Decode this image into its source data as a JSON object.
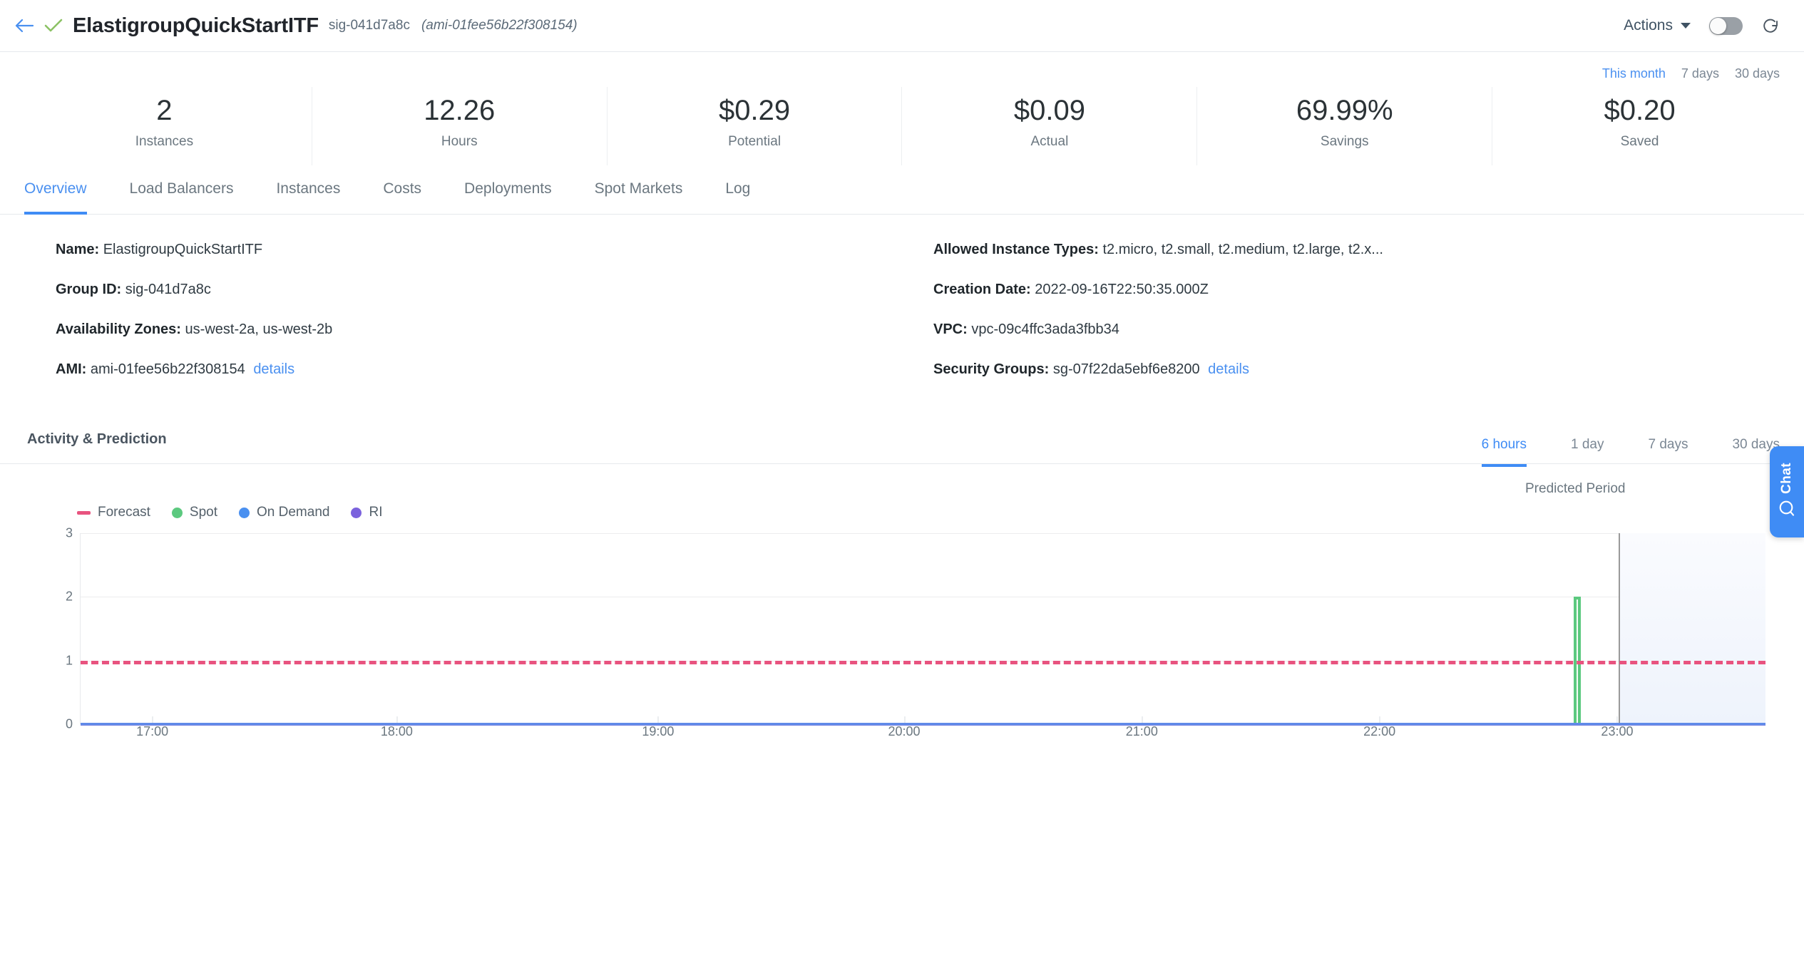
{
  "header": {
    "back_icon": "back-arrow-icon",
    "status_icon": "check-icon",
    "title": "ElastigroupQuickStartITF",
    "group_id": "sig-041d7a8c",
    "ami_paren": "(ami-01fee56b22f308154)",
    "actions_label": "Actions",
    "toggle_state": "off",
    "refresh_icon": "refresh-icon"
  },
  "range_selector": {
    "options": [
      "This month",
      "7 days",
      "30 days"
    ],
    "active": "This month"
  },
  "stats": [
    {
      "value": "2",
      "label": "Instances"
    },
    {
      "value": "12.26",
      "label": "Hours"
    },
    {
      "value": "$0.29",
      "label": "Potential"
    },
    {
      "value": "$0.09",
      "label": "Actual"
    },
    {
      "value": "69.99%",
      "label": "Savings"
    },
    {
      "value": "$0.20",
      "label": "Saved"
    }
  ],
  "tabs": {
    "items": [
      "Overview",
      "Load Balancers",
      "Instances",
      "Costs",
      "Deployments",
      "Spot Markets",
      "Log"
    ],
    "active": "Overview"
  },
  "details": {
    "left": [
      {
        "label": "Name:",
        "value": "ElastigroupQuickStartITF",
        "link": ""
      },
      {
        "label": "Group ID:",
        "value": "sig-041d7a8c",
        "link": ""
      },
      {
        "label": "Availability Zones:",
        "value": "us-west-2a, us-west-2b",
        "link": ""
      },
      {
        "label": "AMI:",
        "value": "ami-01fee56b22f308154",
        "link": "details"
      }
    ],
    "right": [
      {
        "label": "Allowed Instance Types:",
        "value": "t2.micro, t2.small, t2.medium, t2.large, t2.x...",
        "link": ""
      },
      {
        "label": "Creation Date:",
        "value": "2022-09-16T22:50:35.000Z",
        "link": ""
      },
      {
        "label": "VPC:",
        "value": "vpc-09c4ffc3ada3fbb34",
        "link": ""
      },
      {
        "label": "Security Groups:",
        "value": "sg-07f22da5ebf6e8200",
        "link": "details"
      }
    ]
  },
  "activity": {
    "title": "Activity & Prediction",
    "tabs": [
      "6 hours",
      "1 day",
      "7 days",
      "30 days"
    ],
    "active_tab": "6 hours",
    "predicted_period_label": "Predicted Period"
  },
  "chart_data": {
    "type": "line",
    "title": "Activity & Prediction",
    "xlabel": "",
    "ylabel": "",
    "ylim": [
      0,
      3
    ],
    "yticks": [
      "0",
      "1",
      "2",
      "3"
    ],
    "xticks": [
      "17:00",
      "18:00",
      "19:00",
      "20:00",
      "21:00",
      "22:00",
      "23:00"
    ],
    "grid": true,
    "legend_position": "top-left",
    "legend": [
      {
        "name": "Forecast",
        "color": "#e8537f",
        "marker": "dash"
      },
      {
        "name": "Spot",
        "color": "#5cc97f",
        "marker": "dot"
      },
      {
        "name": "On Demand",
        "color": "#4a90f0",
        "marker": "dot"
      },
      {
        "name": "RI",
        "color": "#7b62dd",
        "marker": "dot"
      }
    ],
    "series": [
      {
        "name": "Forecast",
        "color": "#e8537f",
        "style": "dashed",
        "constant_value": 1
      },
      {
        "name": "Spot",
        "color": "#5cc97f",
        "style": "solid",
        "baseline": 0,
        "spike_value": 2,
        "spike_time": "23:28"
      },
      {
        "name": "On Demand",
        "color": "#4a90f0",
        "style": "solid",
        "constant_value": 0
      },
      {
        "name": "RI",
        "color": "#7b62dd",
        "style": "solid",
        "constant_value": 0
      }
    ],
    "predicted_period": {
      "label": "Predicted Period",
      "start_time": "23:33",
      "shaded": true
    }
  },
  "chat": {
    "label": "Chat",
    "icon": "chat-search-icon",
    "color": "#3f8cf5"
  }
}
